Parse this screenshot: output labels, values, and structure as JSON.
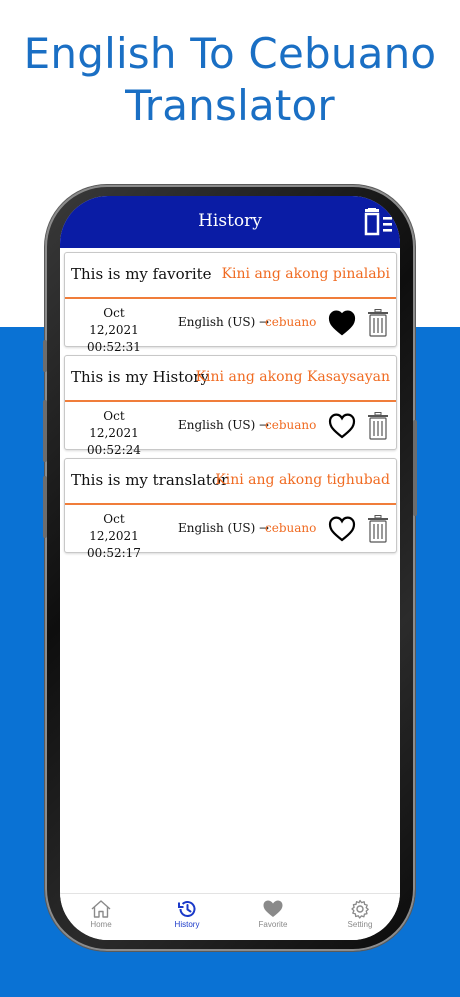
{
  "promo": {
    "line1": "English To Cebuano",
    "line2": "Translator"
  },
  "appbar": {
    "title": "History",
    "clear_icon": "clear-history-icon"
  },
  "colors": {
    "appbar": "#0a1ca5",
    "accent": "#f06b22",
    "band": "#0a72d4",
    "headline": "#1a6fc4"
  },
  "history": [
    {
      "source": "This is my favorite",
      "translation": "Kini ang akong pinalabi",
      "date": "Oct 12,2021",
      "time": "00:52:31",
      "from_lang": "English (US) →",
      "to_lang": "cebuano",
      "favorite": true
    },
    {
      "source": "This is my History",
      "translation": "Kini ang akong Kasaysayan",
      "date": "Oct 12,2021",
      "time": "00:52:24",
      "from_lang": "English (US) →",
      "to_lang": "cebuano",
      "favorite": false
    },
    {
      "source": "This is my translator",
      "translation": "Kini ang akong tighubad",
      "date": "Oct 12,2021",
      "time": "00:52:17",
      "from_lang": "English (US) →",
      "to_lang": "cebuano",
      "favorite": false
    }
  ],
  "tabs": [
    {
      "label": "Home",
      "icon": "home-icon",
      "active": false
    },
    {
      "label": "History",
      "icon": "history-icon",
      "active": true
    },
    {
      "label": "Favorite",
      "icon": "heart-icon",
      "active": false
    },
    {
      "label": "Setting",
      "icon": "gear-icon",
      "active": false
    }
  ]
}
